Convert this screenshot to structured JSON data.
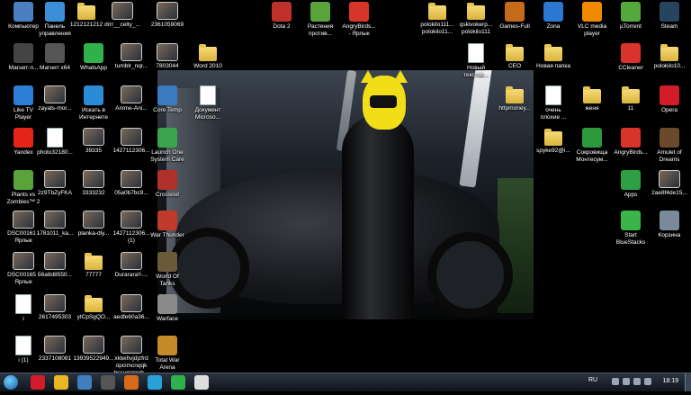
{
  "desktop": {
    "icons": [
      {
        "label": "Компьютер",
        "kind": "app",
        "color": "#4a7fc1"
      },
      {
        "label": "Панель\nуправления",
        "kind": "app",
        "color": "#3b8fd6"
      },
      {
        "label": "1212121212",
        "kind": "folder"
      },
      {
        "label": "drrr__celty_...",
        "kind": "pic"
      },
      {
        "label": "2361059069",
        "kind": "pic"
      },
      {
        "label": "Dota 2",
        "kind": "app",
        "color": "#c0302a"
      },
      {
        "label": "Растения\nпротив...",
        "kind": "app",
        "color": "#5aa33a"
      },
      {
        "label": "AngryBirds...\n- Ярлык",
        "kind": "app",
        "color": "#d8352a"
      },
      {
        "label": "polokilo111...\npolokilo11...",
        "kind": "folder"
      },
      {
        "label": "qskivokerp...\npolokilo111",
        "kind": "folder"
      },
      {
        "label": "Games-Full",
        "kind": "app",
        "color": "#c46a1a"
      },
      {
        "label": "Zona",
        "kind": "app",
        "color": "#2a78d0"
      },
      {
        "label": "VLC media\nplayer",
        "kind": "app",
        "color": "#f28a00"
      },
      {
        "label": "µTorrent",
        "kind": "app",
        "color": "#55a83a"
      },
      {
        "label": "Steam",
        "kind": "app",
        "color": "#27445f"
      },
      {
        "label": "Магнит-п...",
        "kind": "app",
        "color": "#444"
      },
      {
        "label": "Магнит х64",
        "kind": "app",
        "color": "#555"
      },
      {
        "label": "WhatsApp",
        "kind": "app",
        "color": "#2fb14b"
      },
      {
        "label": "tumblr_nqr...",
        "kind": "pic"
      },
      {
        "label": "7803044",
        "kind": "pic"
      },
      {
        "label": "Word 2010",
        "kind": "folder"
      },
      {
        "label": "Новый\nтекстов...",
        "kind": "doc"
      },
      {
        "label": "CEO",
        "kind": "folder"
      },
      {
        "label": "Новая папка",
        "kind": "folder"
      },
      {
        "label": "CCleaner",
        "kind": "app",
        "color": "#d9332b"
      },
      {
        "label": "polokilo10...",
        "kind": "folder"
      },
      {
        "label": "Like TV\nPlayer",
        "kind": "app",
        "color": "#2a7fd4"
      },
      {
        "label": "zayats-mor...",
        "kind": "pic"
      },
      {
        "label": "Искать в\nИнтернете",
        "kind": "app",
        "color": "#2c8bd6"
      },
      {
        "label": "Anime-Ani...",
        "kind": "pic"
      },
      {
        "label": "Core Temp",
        "kind": "app",
        "color": "#3a7ac0"
      },
      {
        "label": "Документ\nMicroso...",
        "kind": "doc"
      },
      {
        "label": "httpmoney...",
        "kind": "folder"
      },
      {
        "label": "очень\nплохие ...",
        "kind": "doc"
      },
      {
        "label": "женя",
        "kind": "folder"
      },
      {
        "label": "11",
        "kind": "folder"
      },
      {
        "label": "Opera",
        "kind": "app",
        "color": "#d21c2a"
      },
      {
        "label": "Yandex",
        "kind": "app",
        "color": "#e42518"
      },
      {
        "label": "photo32180...",
        "kind": "doc"
      },
      {
        "label": "39335",
        "kind": "pic"
      },
      {
        "label": "1427112306...",
        "kind": "pic"
      },
      {
        "label": "Launch One\nSystem Care",
        "kind": "app",
        "color": "#3aa54b"
      },
      {
        "label": "spyke92@i...",
        "kind": "folder"
      },
      {
        "label": "Сокровища\nМонтесум...",
        "kind": "app",
        "color": "#2c9a3a"
      },
      {
        "label": "AngryBirds...",
        "kind": "app",
        "color": "#d8352a"
      },
      {
        "label": "Amulet of\nDreams",
        "kind": "app",
        "color": "#6a4a2a"
      },
      {
        "label": "Plants vs\nZombies™ 2",
        "kind": "app",
        "color": "#5aa33a"
      },
      {
        "label": "2z9TbZyFKA",
        "kind": "pic"
      },
      {
        "label": "3333232",
        "kind": "pic"
      },
      {
        "label": "05a0b7bc9...",
        "kind": "pic"
      },
      {
        "label": "Crossout",
        "kind": "app",
        "color": "#b0302a"
      },
      {
        "label": "Apps",
        "kind": "app",
        "color": "#2ea043"
      },
      {
        "label": "2ae8f4de15...",
        "kind": "pic"
      },
      {
        "label": "DSC00161 -\nЯрлык",
        "kind": "pic"
      },
      {
        "label": "1781011_ka...",
        "kind": "pic"
      },
      {
        "label": "planka-dly...",
        "kind": "pic"
      },
      {
        "label": "1427112306...\n(1)",
        "kind": "pic"
      },
      {
        "label": "War Thunder",
        "kind": "app",
        "color": "#c0392b"
      },
      {
        "label": "Start\nBlueStacks",
        "kind": "app",
        "color": "#3ab54a"
      },
      {
        "label": "Корзина",
        "kind": "app",
        "color": "#7a8a9a"
      },
      {
        "label": "DSC00165 -\nЯрлык",
        "kind": "pic"
      },
      {
        "label": "56a8d8550...",
        "kind": "pic"
      },
      {
        "label": "77777",
        "kind": "folder"
      },
      {
        "label": "Durarara!!-...",
        "kind": "pic"
      },
      {
        "label": "World Of\nTanks",
        "kind": "app",
        "color": "#6a5a3a"
      },
      {
        "label": "i",
        "kind": "doc"
      },
      {
        "label": "2617495303",
        "kind": "pic"
      },
      {
        "label": "ytCpSgQO...",
        "kind": "folder"
      },
      {
        "label": "aedfe60a36...",
        "kind": "pic"
      },
      {
        "label": "Warface",
        "kind": "app",
        "color": "#8a8a8a"
      },
      {
        "label": "i (1)",
        "kind": "doc"
      },
      {
        "label": "2337108081",
        "kind": "pic"
      },
      {
        "label": "13939522949...",
        "kind": "pic"
      },
      {
        "label": "xkteihvjdjzfrd\nopcimcnqqk\nhssumzgoh...",
        "kind": "pic"
      },
      {
        "label": "Total War\nArena",
        "kind": "app",
        "color": "#c28a2a"
      }
    ]
  },
  "taskbar": {
    "start_label": "Start",
    "pinned": [
      {
        "name": "opera",
        "color": "#d21c2a"
      },
      {
        "name": "chrome",
        "color": "#e8b723"
      },
      {
        "name": "explorer-app",
        "color": "#3f7fbf"
      },
      {
        "name": "camera-app",
        "color": "#555"
      },
      {
        "name": "files-app",
        "color": "#d66a1a"
      },
      {
        "name": "skype",
        "color": "#2aa0d8"
      },
      {
        "name": "whatsapp",
        "color": "#2fb14b"
      },
      {
        "name": "yandex-browser",
        "color": "#ddd"
      }
    ],
    "language": "RU",
    "clock": "18:19"
  }
}
